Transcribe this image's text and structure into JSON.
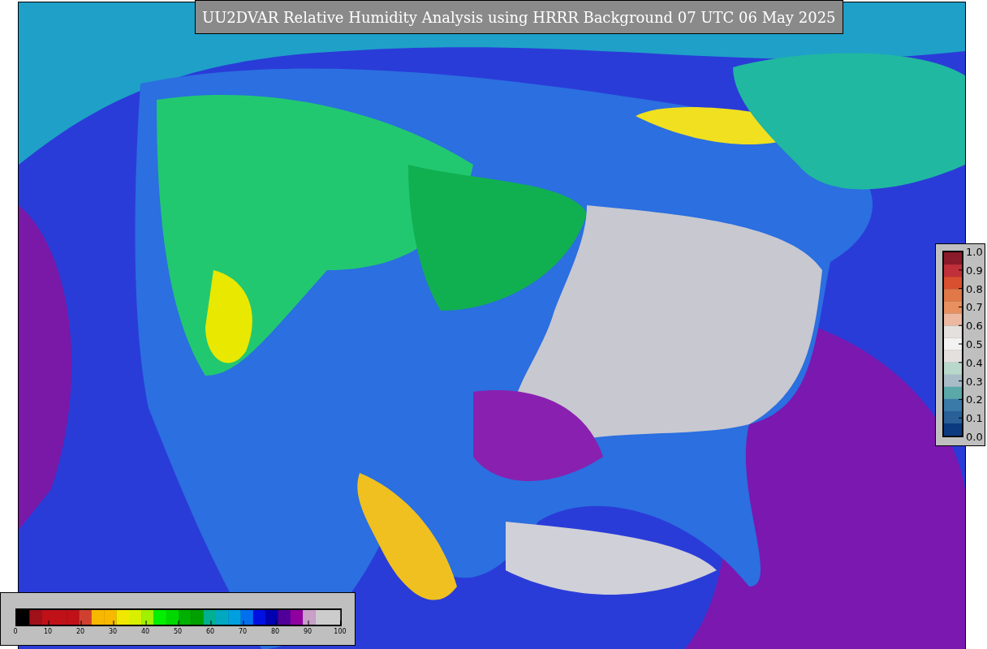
{
  "title": "UU2DVAR Relative Humidity Analysis using HRRR Background 07 UTC 06 May 2025",
  "humidity_colorbar": {
    "ticks": [
      "0",
      "10",
      "20",
      "30",
      "40",
      "50",
      "60",
      "70",
      "80",
      "90",
      "100"
    ]
  },
  "ratio_colorbar": {
    "ticks": [
      "1.0",
      "0.9",
      "0.8",
      "0.7",
      "0.6",
      "0.5",
      "0.4",
      "0.3",
      "0.2",
      "0.1",
      "0.0"
    ]
  }
}
